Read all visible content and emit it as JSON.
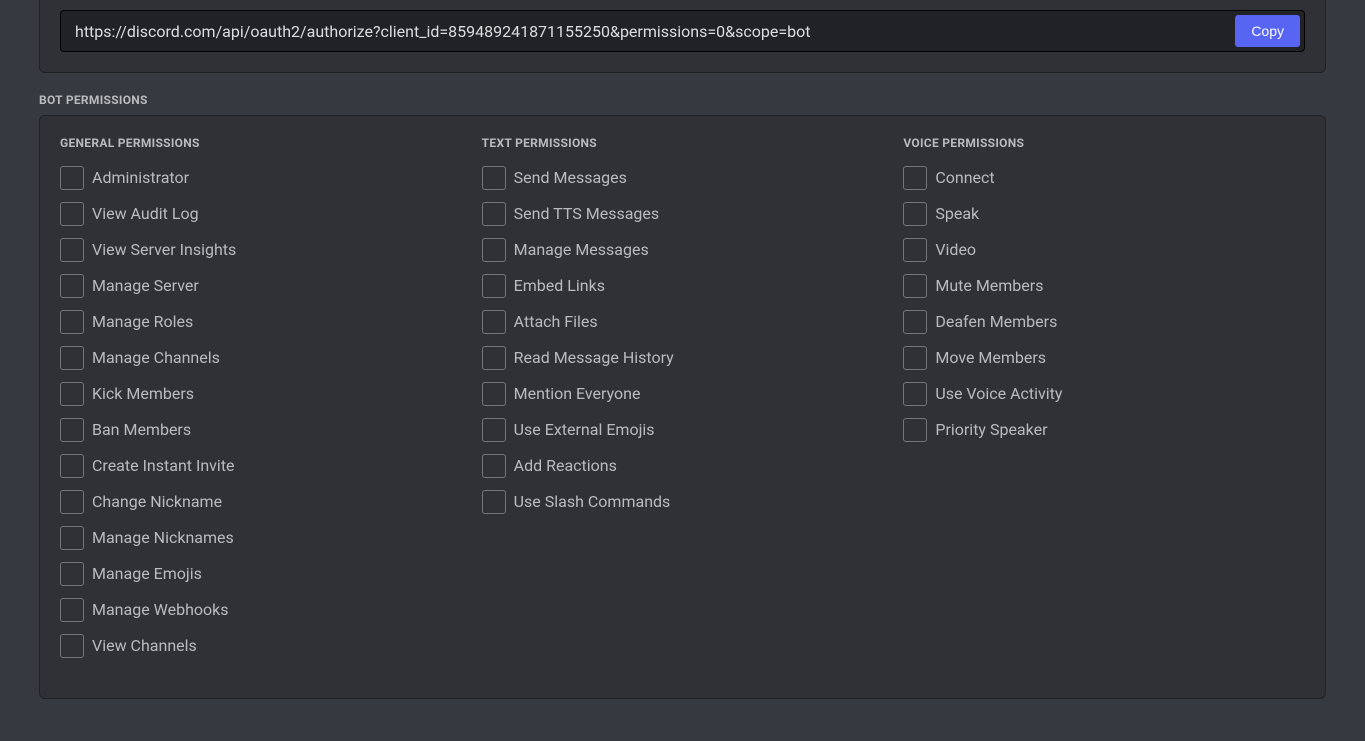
{
  "url_panel": {
    "url_value": "https://discord.com/api/oauth2/authorize?client_id=859489241871155250&permissions=0&scope=bot",
    "copy_label": "Copy"
  },
  "bot_permissions_heading": "BOT PERMISSIONS",
  "columns": {
    "general": {
      "heading": "GENERAL PERMISSIONS",
      "items": [
        "Administrator",
        "View Audit Log",
        "View Server Insights",
        "Manage Server",
        "Manage Roles",
        "Manage Channels",
        "Kick Members",
        "Ban Members",
        "Create Instant Invite",
        "Change Nickname",
        "Manage Nicknames",
        "Manage Emojis",
        "Manage Webhooks",
        "View Channels"
      ]
    },
    "text": {
      "heading": "TEXT PERMISSIONS",
      "items": [
        "Send Messages",
        "Send TTS Messages",
        "Manage Messages",
        "Embed Links",
        "Attach Files",
        "Read Message History",
        "Mention Everyone",
        "Use External Emojis",
        "Add Reactions",
        "Use Slash Commands"
      ]
    },
    "voice": {
      "heading": "VOICE PERMISSIONS",
      "items": [
        "Connect",
        "Speak",
        "Video",
        "Mute Members",
        "Deafen Members",
        "Move Members",
        "Use Voice Activity",
        "Priority Speaker"
      ]
    }
  }
}
